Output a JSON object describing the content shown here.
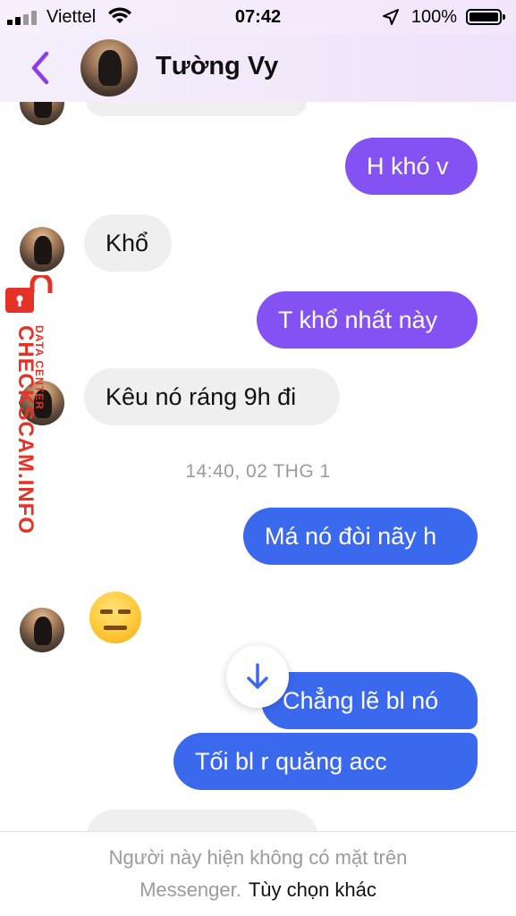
{
  "status_bar": {
    "carrier": "Viettel",
    "time": "07:42",
    "battery": "100%"
  },
  "header": {
    "contact_name": "Tường Vy",
    "accent_color": "#8b3ee8"
  },
  "messages": [
    {
      "type": "sent",
      "text": "H khó v"
    },
    {
      "type": "received",
      "text": "Khổ"
    },
    {
      "type": "sent",
      "text": "T khổ nhất này"
    },
    {
      "type": "received",
      "text": "Kêu nó ráng 9h đi"
    },
    {
      "type": "timestamp",
      "text": "14:40, 02 THG 1"
    },
    {
      "type": "sent",
      "text": "Má nó đòi nãy h"
    },
    {
      "type": "received_emoji",
      "icon": "expressionless-face-emoji"
    },
    {
      "type": "sent",
      "text": "Chẳng lẽ bl nó"
    },
    {
      "type": "sent",
      "text": "Tối       bl r quăng acc"
    }
  ],
  "footer": {
    "line1": "Người này hiện không có mặt trên",
    "line2": "Messenger.",
    "more_options": "Tùy chọn khác"
  },
  "watermark": {
    "main": "CHECKSCAM.INFO",
    "sub": "DATA CENTER"
  },
  "colors": {
    "sent_purple": "#8451f2",
    "sent_blue": "#3b69ee",
    "received_gray": "#efeff0",
    "watermark_red": "#e53227"
  }
}
